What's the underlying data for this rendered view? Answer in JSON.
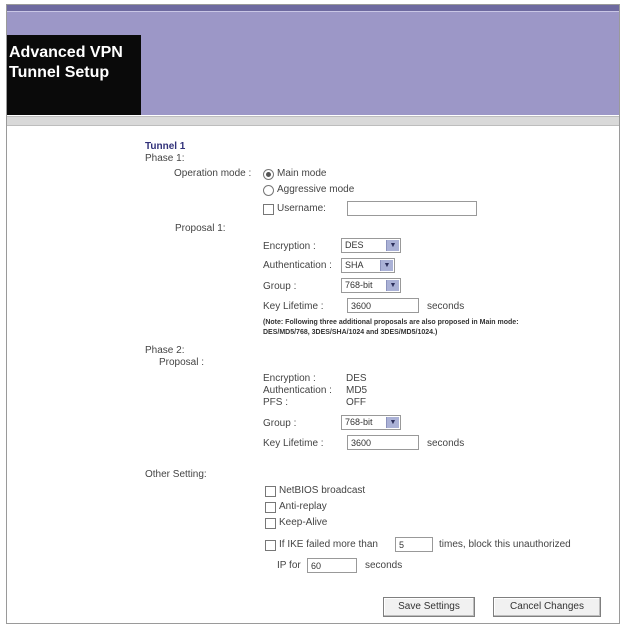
{
  "page": {
    "title_line1": "Advanced VPN",
    "title_line2": "Tunnel Setup"
  },
  "tunnel": {
    "name": "Tunnel 1"
  },
  "phase1": {
    "label": "Phase 1:",
    "operation_mode_label": "Operation mode :",
    "main_mode_label": "Main mode",
    "aggressive_mode_label": "Aggressive mode",
    "username_label": "Username:",
    "username_value": "",
    "selected_mode": "Main mode",
    "proposal_label": "Proposal 1:",
    "encryption_label": "Encryption :",
    "encryption_value": "DES",
    "authentication_label": "Authentication :",
    "authentication_value": "SHA",
    "group_label": "Group :",
    "group_value": "768-bit",
    "key_lifetime_label": "Key Lifetime :",
    "key_lifetime_value": "3600",
    "seconds_label": "seconds",
    "note_line1": "(Note: Following three additional proposals are also proposed in Main mode:",
    "note_line2": "DES/MD5/768, 3DES/SHA/1024 and 3DES/MD5/1024.)"
  },
  "phase2": {
    "label": "Phase 2:",
    "proposal_label": "Proposal :",
    "encryption_label": "Encryption :",
    "encryption_value": "DES",
    "authentication_label": "Authentication :",
    "authentication_value": "MD5",
    "pfs_label": "PFS :",
    "pfs_value": "OFF",
    "group_label": "Group :",
    "group_value": "768-bit",
    "key_lifetime_label": "Key Lifetime :",
    "key_lifetime_value": "3600",
    "seconds_label": "seconds"
  },
  "other": {
    "label": "Other Setting:",
    "netbios_label": "NetBIOS broadcast",
    "antireplay_label": "Anti-replay",
    "keepalive_label": "Keep-Alive",
    "ike_label_pre": "If IKE failed more than",
    "ike_times_value": "5",
    "ike_label_post": "times, block this unauthorized",
    "ip_for_label": "IP for",
    "ip_for_value": "60",
    "seconds_label": "seconds"
  },
  "buttons": {
    "save": "Save Settings",
    "cancel": "Cancel Changes"
  },
  "colors": {
    "header": "#9c97c7",
    "title_bg": "#0a0a0a",
    "section_title": "#31317a"
  },
  "icons": {
    "select_arrow": "chevron-down-icon"
  }
}
